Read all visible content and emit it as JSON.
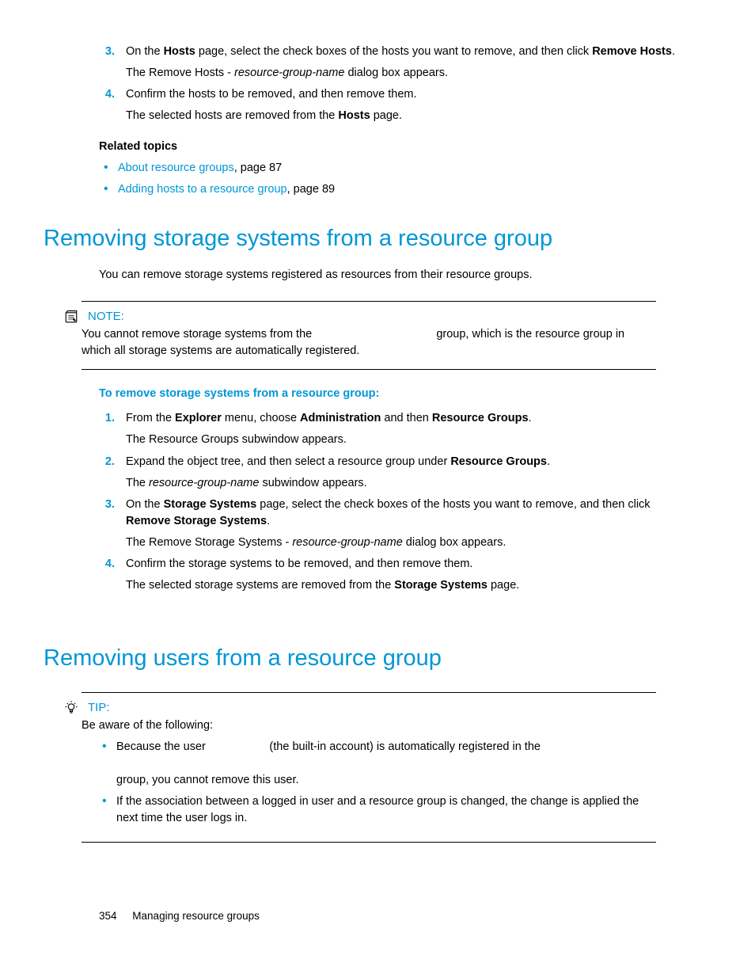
{
  "top_steps": {
    "s3": {
      "num": "3.",
      "text_a": "On the ",
      "hosts": "Hosts",
      "text_b": " page, select the check boxes of the hosts you want to remove, and then click ",
      "remove": "Remove Hosts",
      "period": ".",
      "para_a": "The Remove Hosts - ",
      "para_i": "resource-group-name",
      "para_b": " dialog box appears."
    },
    "s4": {
      "num": "4.",
      "text": "Confirm the hosts to be removed, and then remove them.",
      "para_a": "The selected hosts are removed from the ",
      "hosts": "Hosts",
      "para_b": " page."
    }
  },
  "related": {
    "heading": "Related topics",
    "items": [
      {
        "link": "About resource groups",
        "suffix": ", page 87"
      },
      {
        "link": "Adding hosts to a resource group",
        "suffix": ", page 89"
      }
    ]
  },
  "section1": {
    "title": "Removing storage systems from a resource group",
    "intro": "You can remove storage systems registered as resources from their resource groups.",
    "note_label": "NOTE:",
    "note_body_a": "You cannot remove storage systems from the ",
    "note_body_b": " group, which is the resource group in which all storage systems are automatically registered.",
    "proc_heading": "To remove storage systems from a resource group:",
    "steps": {
      "s1": {
        "num": "1.",
        "a": "From the ",
        "b1": "Explorer",
        "c": " menu, choose ",
        "b2": "Administration",
        "d": " and then ",
        "b3": "Resource Groups",
        "e": ".",
        "p": "The Resource Groups subwindow appears."
      },
      "s2": {
        "num": "2.",
        "a": "Expand the object tree, and then select a resource group under ",
        "b1": "Resource Groups",
        "e": ".",
        "p_a": "The ",
        "p_i": "resource-group-name",
        "p_b": " subwindow appears."
      },
      "s3": {
        "num": "3.",
        "a": "On the ",
        "b1": "Storage Systems",
        "c": " page, select the check boxes of the hosts you want to remove, and then click ",
        "b2": "Remove Storage Systems",
        "e": ".",
        "p_a": "The Remove Storage Systems - ",
        "p_i": "resource-group-name",
        "p_b": " dialog box appears."
      },
      "s4": {
        "num": "4.",
        "a": "Confirm the storage systems to be removed, and then remove them.",
        "p_a": "The selected storage systems are removed from the ",
        "p_b1": "Storage Systems",
        "p_b": " page."
      }
    }
  },
  "section2": {
    "title": "Removing users from a resource group",
    "tip_label": "TIP:",
    "tip_intro": "Be aware of the following:",
    "tip1_a": "Because the user ",
    "tip1_b": " (the built-in account) is automatically registered in the ",
    "tip1_c": " group, you cannot remove this user.",
    "tip2": "If the association between a logged in user and a resource group is changed, the change is applied the next time the user logs in."
  },
  "footer": {
    "page": "354",
    "chapter": "Managing resource groups"
  }
}
